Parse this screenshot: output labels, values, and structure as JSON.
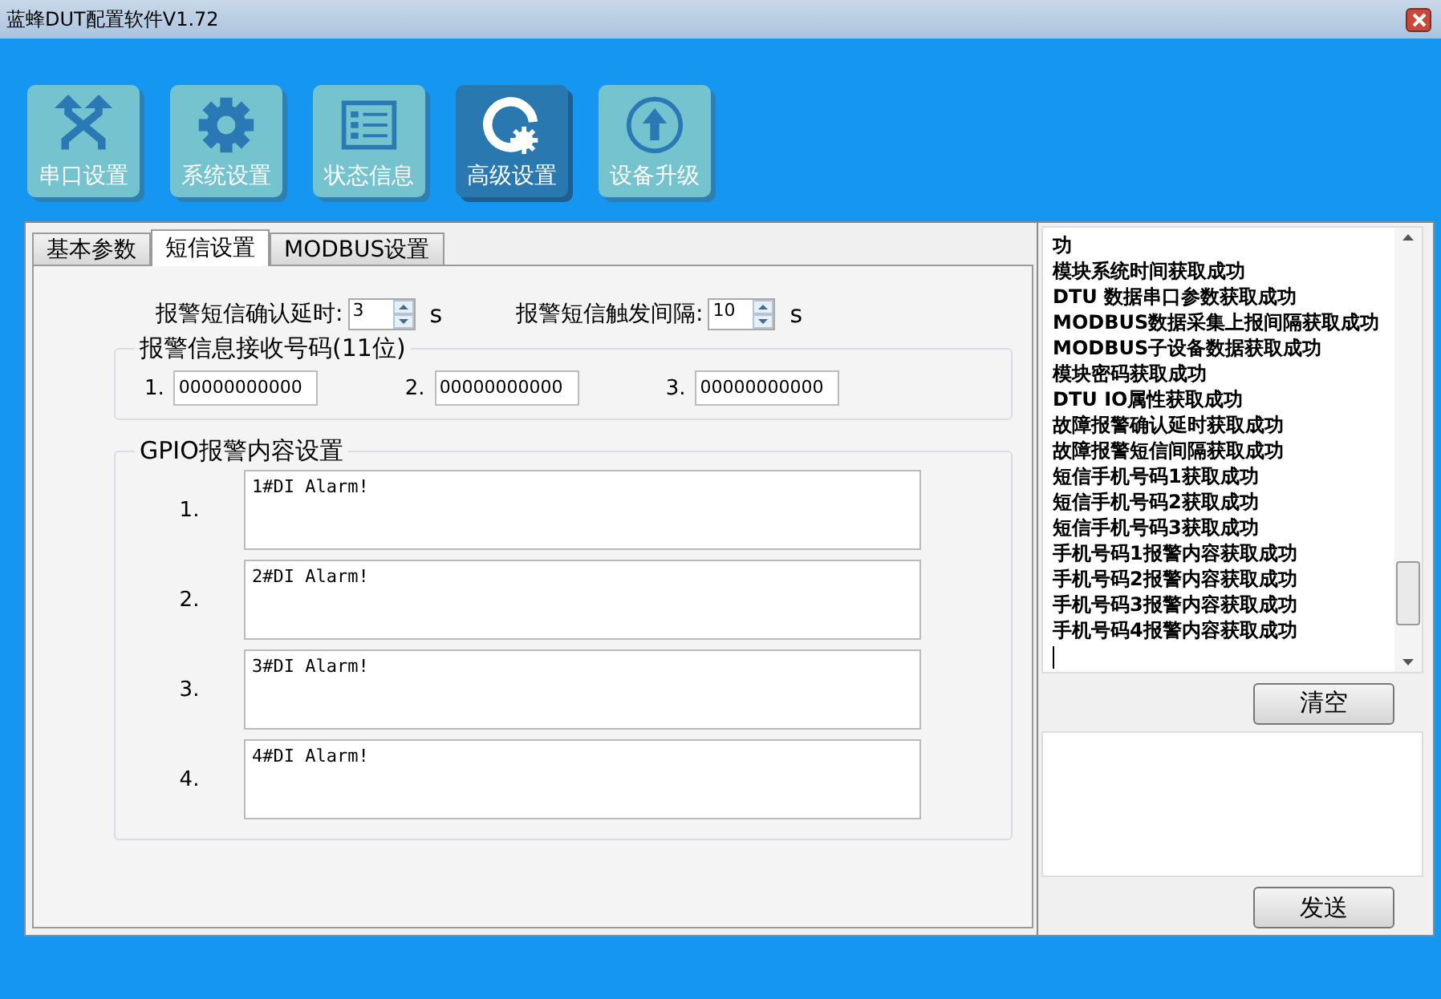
{
  "window": {
    "title": "蓝蜂DUT配置软件V1.72"
  },
  "toolbar": [
    {
      "label": "串口设置",
      "selected": false
    },
    {
      "label": "系统设置",
      "selected": false
    },
    {
      "label": "状态信息",
      "selected": false
    },
    {
      "label": "高级设置",
      "selected": true
    },
    {
      "label": "设备升级",
      "selected": false
    }
  ],
  "tabs": [
    {
      "label": "基本参数",
      "selected": false
    },
    {
      "label": "短信设置",
      "selected": true
    },
    {
      "label": "MODBUS设置",
      "selected": false
    }
  ],
  "settings": [
    {
      "label": "报警短信确认延时:",
      "value": "3",
      "unit": "s"
    },
    {
      "label": "报警短信触发间隔:",
      "value": "10",
      "unit": "s"
    }
  ],
  "phone_group": {
    "title": "报警信息接收号码(11位)",
    "numbers": [
      {
        "index": "1.",
        "value": "00000000000"
      },
      {
        "index": "2.",
        "value": "00000000000"
      },
      {
        "index": "3.",
        "value": "00000000000"
      }
    ]
  },
  "gpio_group": {
    "title": "GPIO报警内容设置",
    "messages": [
      {
        "index": "1.",
        "value": "1#DI Alarm!"
      },
      {
        "index": "2.",
        "value": "2#DI Alarm!"
      },
      {
        "index": "3.",
        "value": "3#DI Alarm!"
      },
      {
        "index": "4.",
        "value": "4#DI Alarm!"
      }
    ]
  },
  "log": {
    "lines": [
      "功",
      "模块系统时间获取成功",
      "DTU 数据串口参数获取成功",
      "MODBUS数据采集上报间隔获取成功",
      "MODBUS子设备数据获取成功",
      "模块密码获取成功",
      "DTU IO属性获取成功",
      "故障报警确认延时获取成功",
      "故障报警短信间隔获取成功",
      "短信手机号码1获取成功",
      "短信手机号码2获取成功",
      "短信手机号码3获取成功",
      "手机号码1报警内容获取成功",
      "手机号码2报警内容获取成功",
      "手机号码3报警内容获取成功",
      "手机号码4报警内容获取成功"
    ]
  },
  "clear_button": "清空",
  "send_button": "发送"
}
